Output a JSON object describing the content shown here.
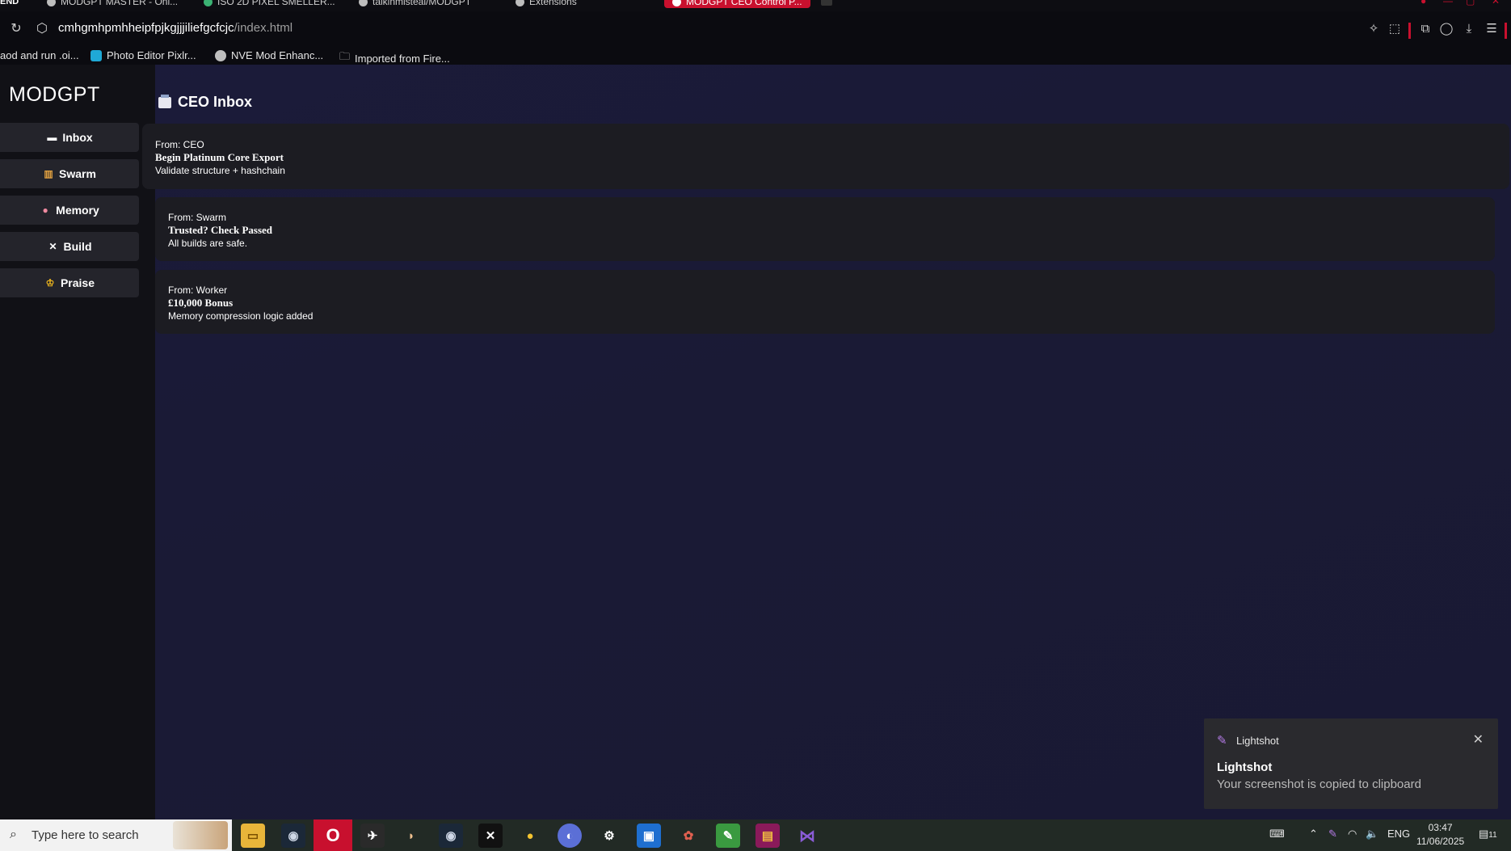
{
  "browser": {
    "tabs": [
      {
        "label": "MODGPT MASTER - Onl..."
      },
      {
        "label": "ISO 2D PIXEL SMELLER..."
      },
      {
        "label": "talkinmisteal/MODGPT"
      },
      {
        "label": "Extensions"
      },
      {
        "label": "MODGPT CEO Control P..."
      }
    ],
    "url_host": "cmhgmhpmhheipfpjkgjjjiliefgcfcjc",
    "url_path": "/index.html",
    "bookmarks": [
      {
        "label": "aod and run .oi..."
      },
      {
        "label": "Photo Editor Pixlr..."
      },
      {
        "label": "NVE Mod Enhanc..."
      },
      {
        "label": "Imported from Fire..."
      }
    ]
  },
  "app": {
    "brand": "MODGPT",
    "nav": [
      {
        "label": "Inbox",
        "icon": "inbox-icon"
      },
      {
        "label": "Swarm",
        "icon": "chart-icon"
      },
      {
        "label": "Memory",
        "icon": "brain-icon"
      },
      {
        "label": "Build",
        "icon": "tools-icon"
      },
      {
        "label": "Praise",
        "icon": "trophy-icon"
      }
    ],
    "page_title": "CEO Inbox",
    "messages": [
      {
        "from": "From: CEO",
        "subject": "Begin Platinum Core Export",
        "body": "Validate structure + hashchain"
      },
      {
        "from": "From: Swarm",
        "subject": "Trusted? Check Passed",
        "body": "All builds are safe."
      },
      {
        "from": "From: Worker",
        "subject": "£10,000 Bonus",
        "body": "Memory compression logic added"
      }
    ]
  },
  "toast": {
    "app_name": "Lightshot",
    "title": "Lightshot",
    "message": "Your screenshot is copied to clipboard"
  },
  "taskbar": {
    "search_placeholder": "Type here to search",
    "language": "ENG",
    "time": "03:47",
    "date": "11/06/2025",
    "notification_count": "11"
  },
  "colors": {
    "accent": "#c8102e",
    "card_bg": "#1c1c22",
    "sidebar_bg": "#111116",
    "nav_btn_bg": "#24242b"
  }
}
